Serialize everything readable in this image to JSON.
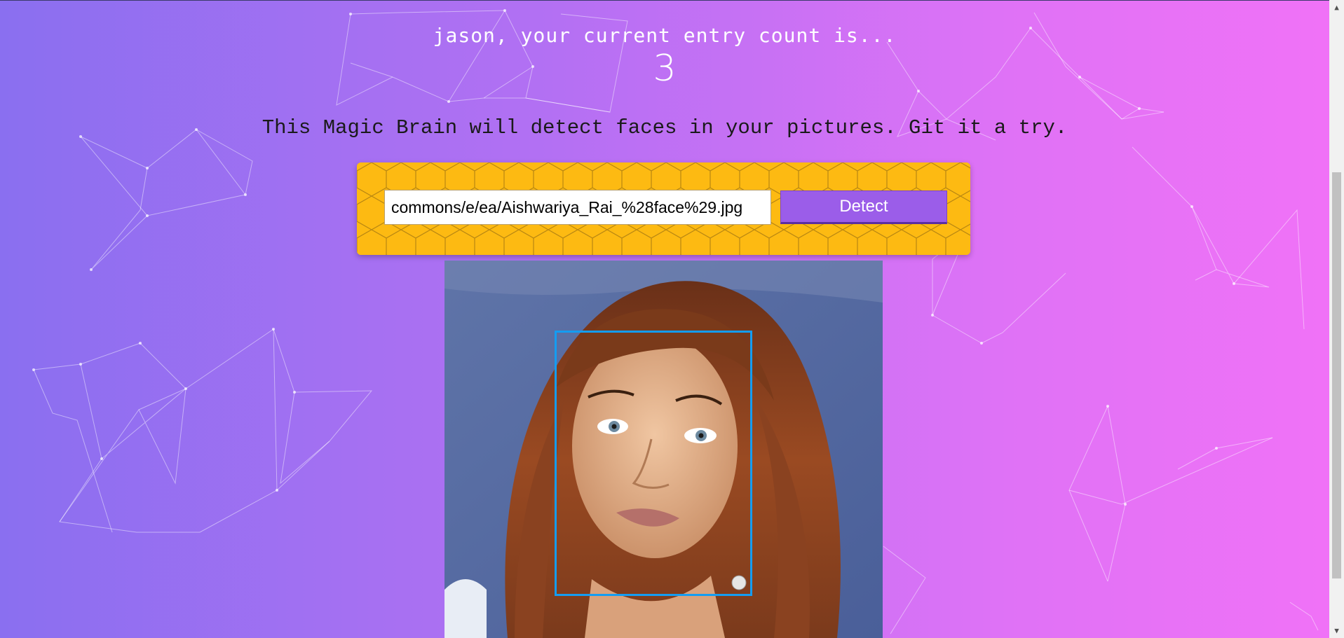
{
  "user": {
    "greeting": "jason, your current entry count is...",
    "entry_count": "3"
  },
  "intro": {
    "tagline": "This Magic Brain will detect faces in your pictures. Git it a try."
  },
  "form": {
    "image_url": "commons/e/ea/Aishwariya_Rai_%28face%29.jpg",
    "detect_label": "Detect"
  },
  "colors": {
    "gradient_start": "#8a6ff0",
    "gradient_end": "#f172f7",
    "panel": "#fdba12",
    "button": "#9b5de9",
    "face_box": "#149df2"
  },
  "icons": {
    "scroll_up": "chevron-up-icon",
    "scroll_down": "chevron-down-icon"
  }
}
